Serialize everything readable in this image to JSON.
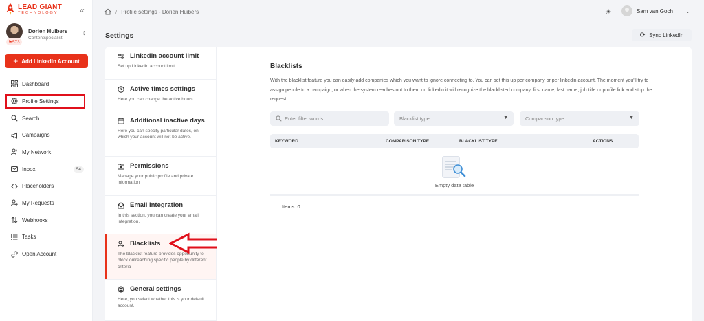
{
  "brand": {
    "line1": "LEAD GIANT",
    "line2": "TECHNOLOGY",
    "color": "#e8321a"
  },
  "user": {
    "name": "Dorien Huibers",
    "role": "Contentspecialist",
    "badge": "573"
  },
  "sidebar": {
    "add_button": "Add LinkedIn Account",
    "items": [
      {
        "label": "Dashboard",
        "icon": "dashboard-icon"
      },
      {
        "label": "Profile Settings",
        "icon": "gear-icon",
        "active": true
      },
      {
        "label": "Search",
        "icon": "search-icon"
      },
      {
        "label": "Campaigns",
        "icon": "megaphone-icon"
      },
      {
        "label": "My Network",
        "icon": "network-icon"
      },
      {
        "label": "Inbox",
        "icon": "inbox-icon",
        "count": "54"
      },
      {
        "label": "Placeholders",
        "icon": "code-icon"
      },
      {
        "label": "My Requests",
        "icon": "user-add-icon"
      },
      {
        "label": "Webhooks",
        "icon": "sort-arrows-icon"
      },
      {
        "label": "Tasks",
        "icon": "list-icon"
      },
      {
        "label": "Open Account",
        "icon": "link-icon"
      }
    ]
  },
  "topbar": {
    "breadcrumb": "Profile settings - Dorien Huibers",
    "user_name": "Sam van Goch"
  },
  "page": {
    "title": "Settings",
    "sync_button": "Sync LinkedIn"
  },
  "settings_menu": [
    {
      "title": "LinkedIn account limit",
      "desc": "Set up LinkedIn account limit",
      "icon": "sliders-icon"
    },
    {
      "title": "Active times settings",
      "desc": "Here you can change the active hours",
      "icon": "clock-icon"
    },
    {
      "title": "Additional inactive days",
      "desc": "Here you can specify particular dates, on which your account will not be active.",
      "icon": "calendar-icon"
    },
    {
      "title": "Permissions",
      "desc": "Manage your public profile and private information",
      "icon": "folder-lock-icon"
    },
    {
      "title": "Email integration",
      "desc": "In this section, you can create your email integration.",
      "icon": "envelope-icon"
    },
    {
      "title": "Blacklists",
      "desc": "The blacklist feature provides opportunity to block outreaching specific people by different criteria",
      "icon": "user-block-icon",
      "active": true
    },
    {
      "title": "General settings",
      "desc": "Here, you select whether this is your default account.",
      "icon": "gear-icon"
    }
  ],
  "blacklists": {
    "title": "Blacklists",
    "description": "With the blacklist feature you can easily add companies which you want to ignore connecting to. You can set this up per company or per linkedin account. The moment you'll try to assign people to a campaign, or when the system reaches out to them on linkedin it will recognize the blacklisted company, first name, last name, job title or profile link and stop the request.",
    "filter_placeholder": "Enter filter words",
    "blacklist_type": "Blacklist type",
    "comparison_type": "Comparison type",
    "columns": [
      "KEYWORD",
      "COMPARISON TYPE",
      "BLACKLIST TYPE",
      "ACTIONS"
    ],
    "empty_text": "Empty data table",
    "items_label": "Items: 0"
  }
}
